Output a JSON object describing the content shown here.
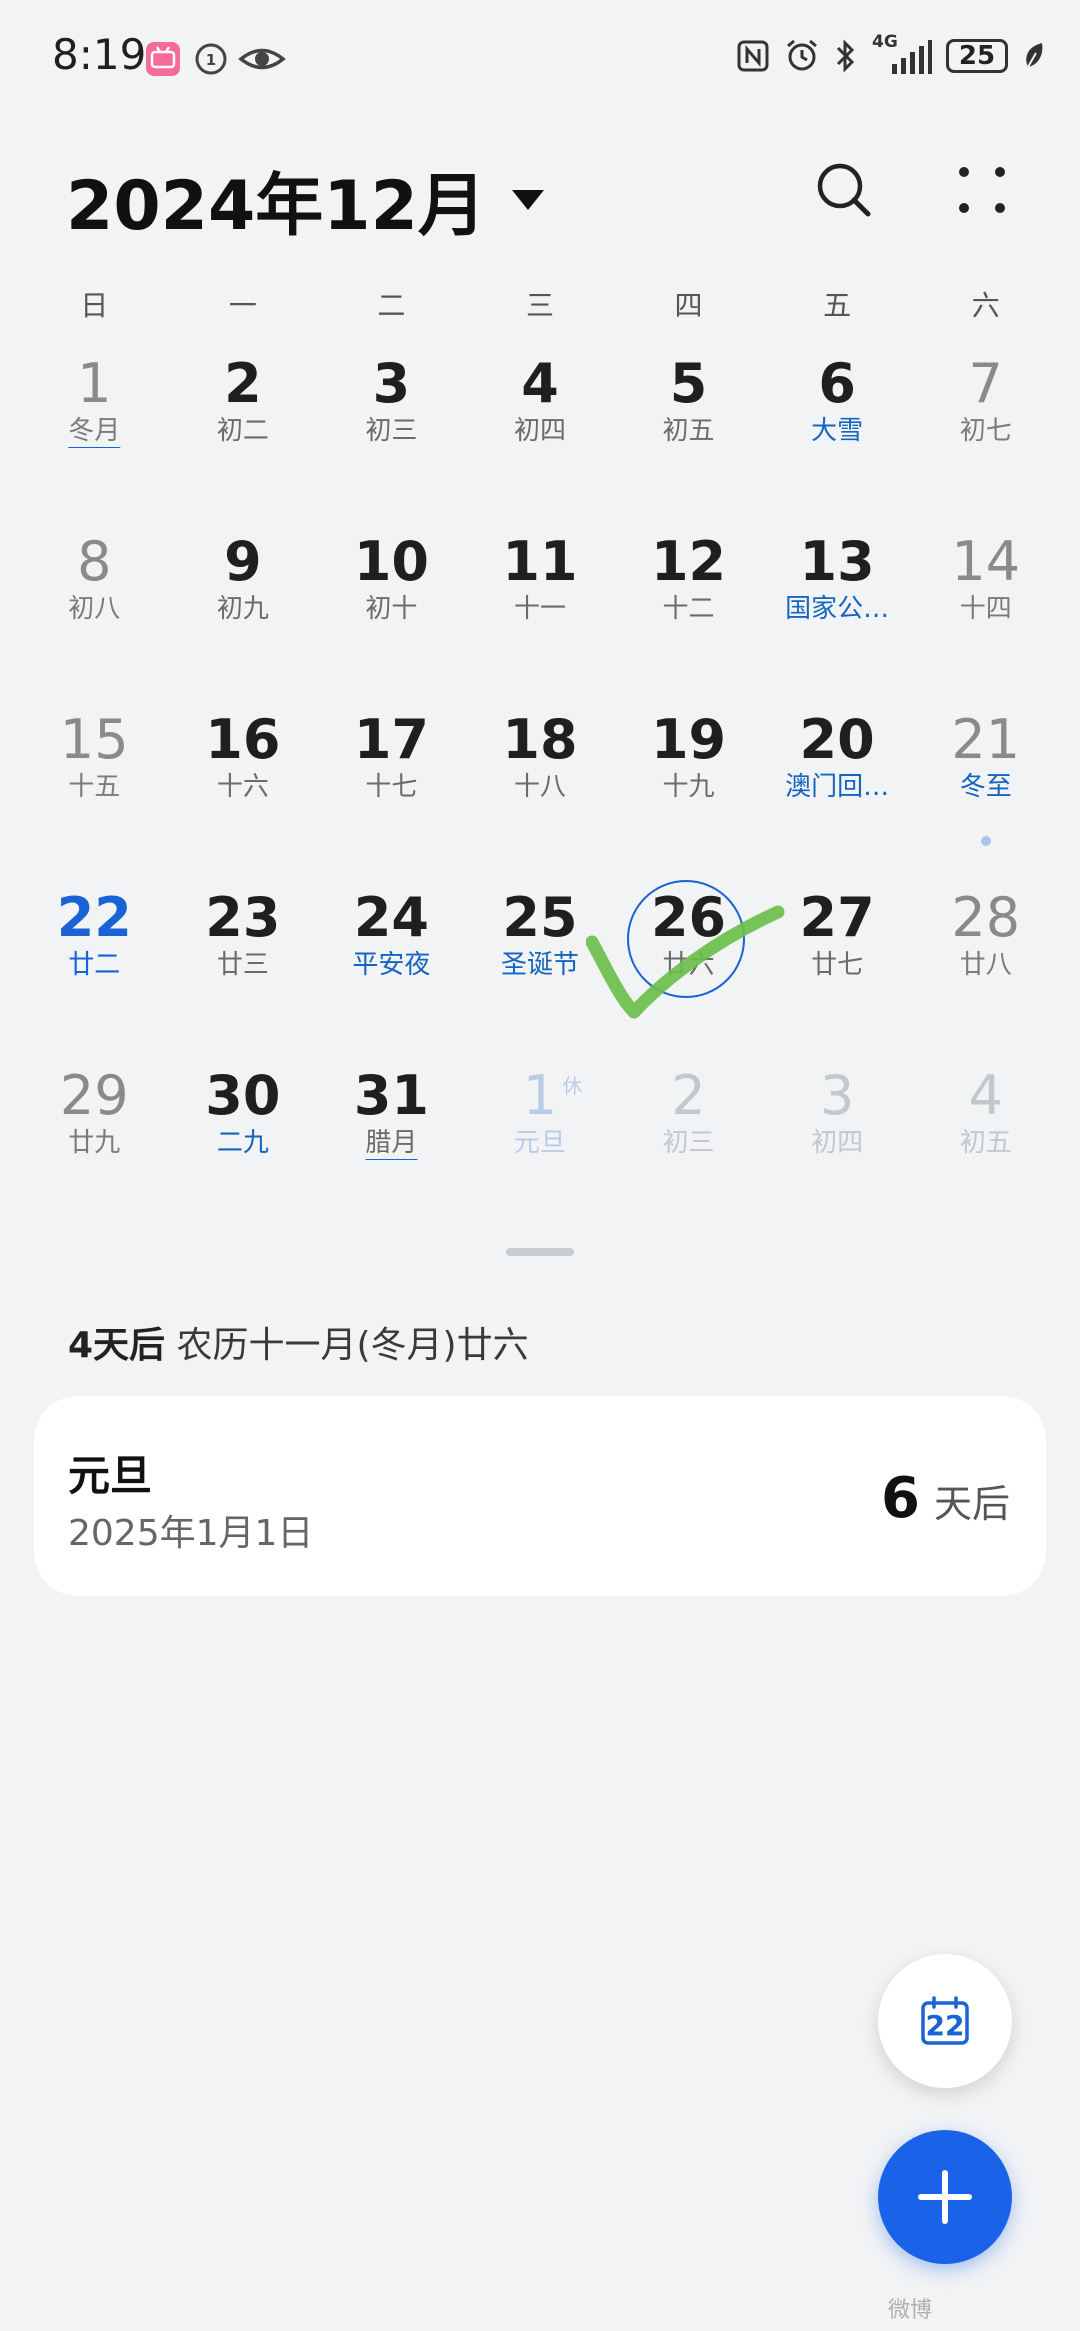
{
  "status_bar": {
    "time": "8:19",
    "battery": "25",
    "network": "4G"
  },
  "header": {
    "month_title": "2024年12月"
  },
  "weekdays": [
    "日",
    "一",
    "二",
    "三",
    "四",
    "五",
    "六"
  ],
  "calendar": [
    {
      "day": "1",
      "lunar": "冬月",
      "kind": "weekend underline"
    },
    {
      "day": "2",
      "lunar": "初二",
      "kind": ""
    },
    {
      "day": "3",
      "lunar": "初三",
      "kind": ""
    },
    {
      "day": "4",
      "lunar": "初四",
      "kind": ""
    },
    {
      "day": "5",
      "lunar": "初五",
      "kind": ""
    },
    {
      "day": "6",
      "lunar": "大雪",
      "kind": "holiday"
    },
    {
      "day": "7",
      "lunar": "初七",
      "kind": "weekend"
    },
    {
      "day": "8",
      "lunar": "初八",
      "kind": "weekend"
    },
    {
      "day": "9",
      "lunar": "初九",
      "kind": ""
    },
    {
      "day": "10",
      "lunar": "初十",
      "kind": ""
    },
    {
      "day": "11",
      "lunar": "十一",
      "kind": ""
    },
    {
      "day": "12",
      "lunar": "十二",
      "kind": ""
    },
    {
      "day": "13",
      "lunar": "国家公…",
      "kind": "holiday"
    },
    {
      "day": "14",
      "lunar": "十四",
      "kind": "weekend"
    },
    {
      "day": "15",
      "lunar": "十五",
      "kind": "weekend"
    },
    {
      "day": "16",
      "lunar": "十六",
      "kind": ""
    },
    {
      "day": "17",
      "lunar": "十七",
      "kind": ""
    },
    {
      "day": "18",
      "lunar": "十八",
      "kind": ""
    },
    {
      "day": "19",
      "lunar": "十九",
      "kind": ""
    },
    {
      "day": "20",
      "lunar": "澳门回…",
      "kind": "holiday"
    },
    {
      "day": "21",
      "lunar": "冬至",
      "kind": "weekend holiday dot"
    },
    {
      "day": "22",
      "lunar": "廿二",
      "kind": "today"
    },
    {
      "day": "23",
      "lunar": "廿三",
      "kind": ""
    },
    {
      "day": "24",
      "lunar": "平安夜",
      "kind": "holiday"
    },
    {
      "day": "25",
      "lunar": "圣诞节",
      "kind": "holiday"
    },
    {
      "day": "26",
      "lunar": "廿六",
      "kind": "selected"
    },
    {
      "day": "27",
      "lunar": "廿七",
      "kind": ""
    },
    {
      "day": "28",
      "lunar": "廿八",
      "kind": "weekend"
    },
    {
      "day": "29",
      "lunar": "廿九",
      "kind": "weekend"
    },
    {
      "day": "30",
      "lunar": "二九",
      "kind": "holiday"
    },
    {
      "day": "31",
      "lunar": "腊月",
      "kind": "underline"
    },
    {
      "day": "1",
      "lunar": "元旦",
      "kind": "other holiday",
      "badge": "休"
    },
    {
      "day": "2",
      "lunar": "初三",
      "kind": "other"
    },
    {
      "day": "3",
      "lunar": "初四",
      "kind": "other"
    },
    {
      "day": "4",
      "lunar": "初五",
      "kind": "other"
    }
  ],
  "info": {
    "days_after": "4天后",
    "lunar_date": "农历十一月(冬月)廿六"
  },
  "event_card": {
    "title": "元旦",
    "date": "2025年1月1日",
    "count": "6",
    "unit": "天后"
  },
  "fab": {
    "today_day": "22"
  },
  "watermark": "微博"
}
